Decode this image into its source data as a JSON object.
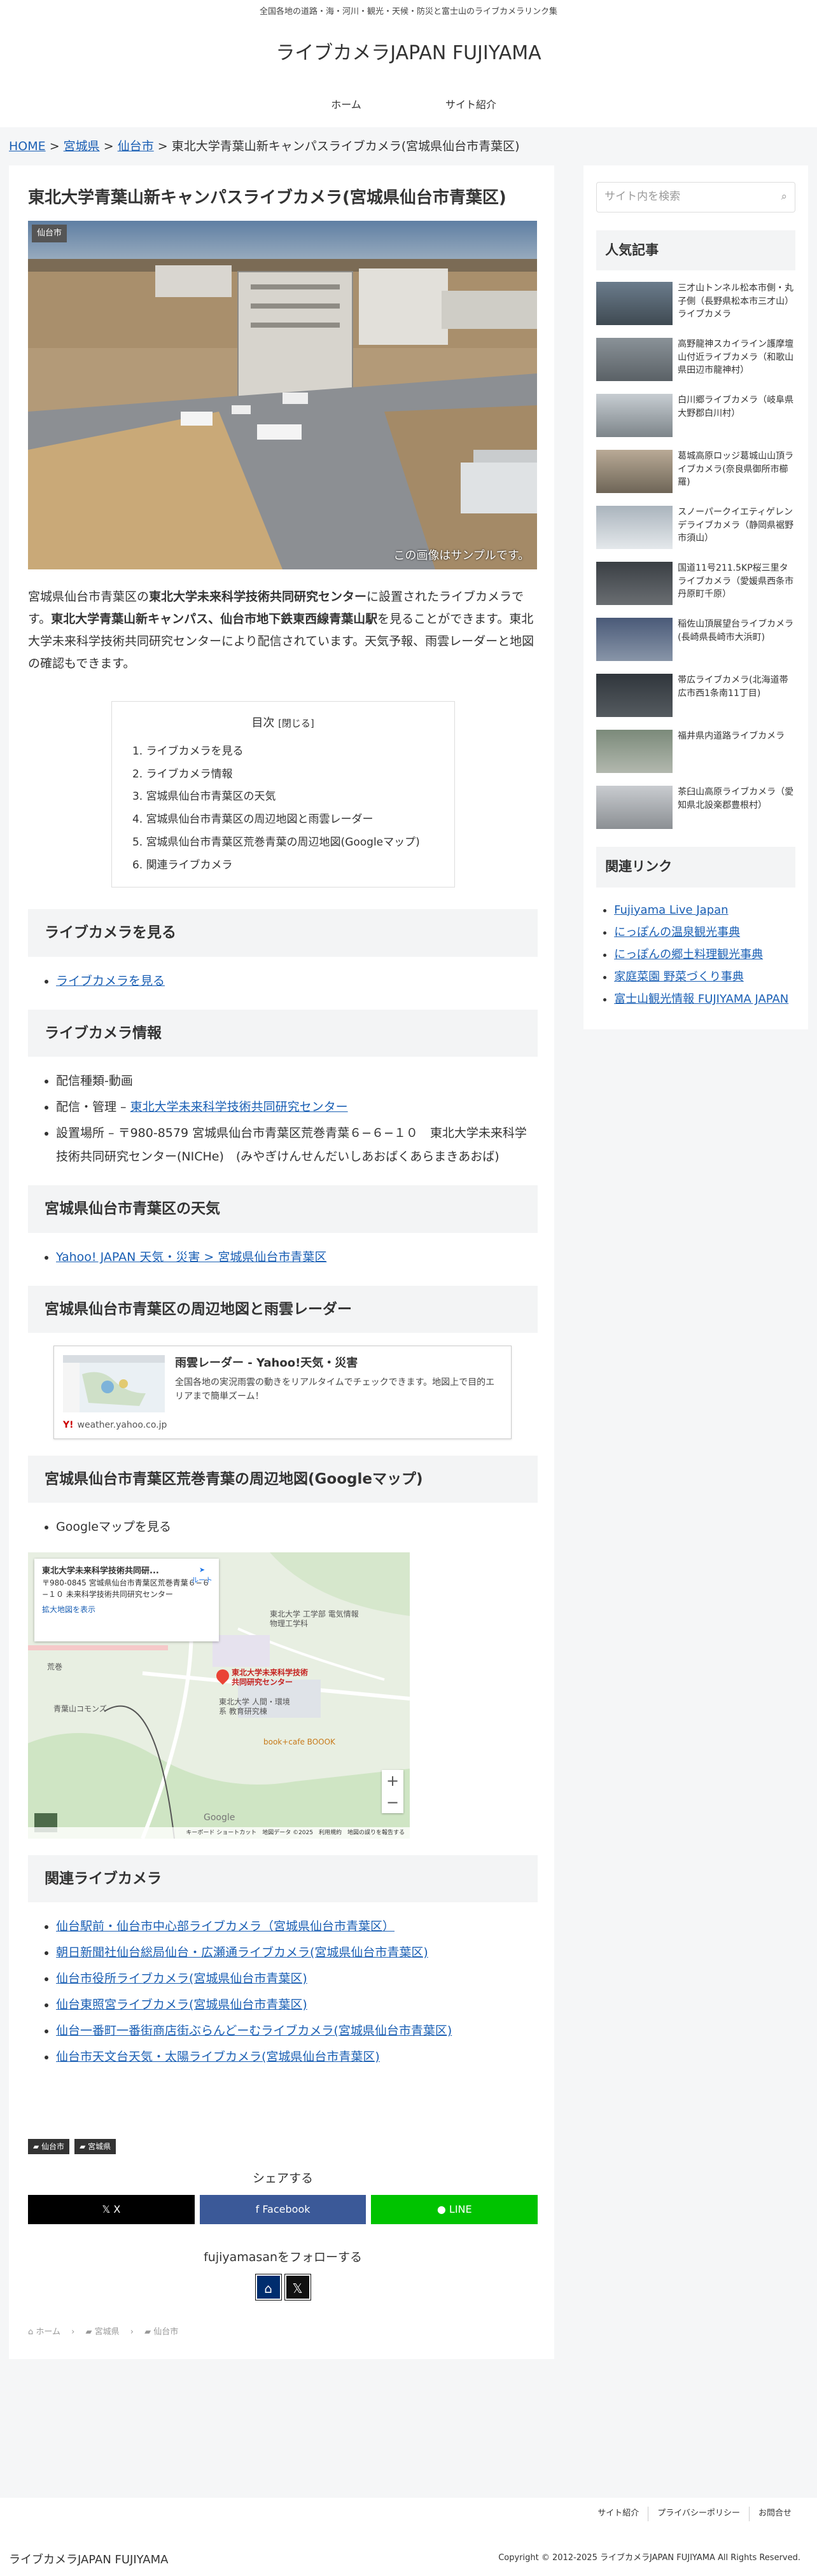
{
  "header": {
    "tagline": "全国各地の道路・海・河川・観光・天候・防災と富士山のライブカメラリンク集",
    "site_name": "ライブカメラJAPAN FUJIYAMA",
    "nav": [
      "ホーム",
      "サイト紹介"
    ]
  },
  "breadcrumb": {
    "home": "HOME",
    "pref": "宮城県",
    "city": "仙台市",
    "current": "東北大学青葉山新キャンパスライブカメラ(宮城県仙台市青葉区)",
    "sep": ">"
  },
  "article": {
    "title": "東北大学青葉山新キャンパスライブカメラ(宮城県仙台市青葉区)",
    "category_label": "仙台市",
    "sample_note": "この画像はサンプルです。",
    "lead_1": "宮城県仙台市青葉区の",
    "lead_b1": "東北大学未来科学技術共同研究センター",
    "lead_2": "に設置されたライブカメラです。",
    "lead_b2": "東北大学青葉山新キャンパス、仙台市地下鉄東西線青葉山駅",
    "lead_3": "を見ることができます。東北大学未来科学技術共同研究センターにより配信されています。天気予報、雨雲レーダーと地図の確認もできます。",
    "toc": {
      "title": "目次",
      "toggle": "[閉じる]",
      "items": [
        "ライブカメラを見る",
        "ライブカメラ情報",
        "宮城県仙台市青葉区の天気",
        "宮城県仙台市青葉区の周辺地図と雨雲レーダー",
        "宮城県仙台市青葉区荒巻青葉の周辺地図(Googleマップ)",
        "関連ライブカメラ"
      ]
    },
    "sections": {
      "watch": {
        "heading": "ライブカメラを見る",
        "link": "ライブカメラを見る"
      },
      "info": {
        "heading": "ライブカメラ情報",
        "item1": "配信種類-動画",
        "item2_prefix": "配信・管理 – ",
        "item2_link": "東北大学未来科学技術共同研究センター",
        "item3": "設置場所 – 〒980-8579 宮城県仙台市青葉区荒巻青葉６−６−１０　東北大学未来科学技術共同研究センター(NICHe)　(みやぎけんせんだいしあおばくあらまきあおば)"
      },
      "weather": {
        "heading": "宮城県仙台市青葉区の天気",
        "link": "Yahoo! JAPAN 天気・災害 > 宮城県仙台市青葉区"
      },
      "radar": {
        "heading": "宮城県仙台市青葉区の周辺地図と雨雲レーダー",
        "card_title": "雨雲レーダー - Yahoo!天気・災害",
        "card_desc": "全国各地の実況雨雲の動きをリアルタイムでチェックできます。地図上で目的エリアまで簡単ズーム！",
        "card_site": "weather.yahoo.co.jp",
        "card_fav": "Y!"
      },
      "gmap": {
        "heading": "宮城県仙台市青葉区荒巻青葉の周辺地図(Googleマップ)",
        "item": "Googleマップを見る",
        "card_title": "東北大学未来科学技術共同研...",
        "card_addr": "〒980-0845 宮城県仙台市青葉区荒巻青葉６−６−１０ 未来科学技術共同研究センター",
        "card_link": "拡大地図を表示",
        "card_route": "ルート",
        "pin_label": "東北大学未来科学技術共同研究センター",
        "place1": "東北大学 工学部 電気情報物理工学科",
        "place2": "青葉山コモンズ",
        "place3": "東北大学 人間・環境系 教育研究棟",
        "place4": "book+cafe BOOOK",
        "place5": "荒巻",
        "zoom_in": "+",
        "zoom_out": "−",
        "google": "Google",
        "footer": "キーボード ショートカット　地図データ ©2025　利用規約　地図の誤りを報告する"
      },
      "related": {
        "heading": "関連ライブカメラ",
        "links": [
          "仙台駅前・仙台市中心部ライブカメラ（宮城県仙台市青葉区）",
          "朝日新聞社仙台総局仙台・広瀬通ライブカメラ(宮城県仙台市青葉区)",
          "仙台市役所ライブカメラ(宮城県仙台市青葉区)",
          "仙台東照宮ライブカメラ(宮城県仙台市青葉区)",
          "仙台一番町一番街商店街ぶらんどーむライブカメラ(宮城県仙台市青葉区)",
          "仙台市天文台天気・太陽ライブカメラ(宮城県仙台市青葉区)"
        ]
      }
    },
    "tags": [
      "仙台市",
      "宮城県"
    ],
    "share": {
      "title": "シェアする",
      "x": "X",
      "facebook": "Facebook",
      "line": "LINE"
    },
    "follow": {
      "title": "fujiyamasanをフォローする"
    },
    "bottom_breadcrumb": [
      "ホーム",
      "宮城県",
      "仙台市"
    ]
  },
  "sidebar": {
    "search_placeholder": "サイト内を検索",
    "popular_title": "人気記事",
    "popular": [
      "三才山トンネル松本市側・丸子側（長野県松本市三才山）ライブカメラ",
      "高野龍神スカイライン護摩壇山付近ライブカメラ（和歌山県田辺市龍神村）",
      "白川郷ライブカメラ（岐阜県大野郡白川村）",
      "葛城高原ロッジ葛城山山頂ライブカメラ(奈良県御所市櫛羅)",
      "スノーパークイエティゲレンデライブカメラ（静岡県裾野市須山）",
      "国道11号211.5KP桜三里タライブカメラ（愛媛県西条市丹原町千原）",
      "稲佐山頂展望台ライブカメラ(長崎県長崎市大浜町)",
      "帯広ライブカメラ(北海道帯広市西1条南11丁目)",
      "福井県内道路ライブカメラ",
      "茶臼山高原ライブカメラ（愛知県北設楽郡豊根村）"
    ],
    "links_title": "関連リンク",
    "links": [
      "Fujiyama Live Japan",
      "にっぽんの温泉観光事典",
      "にっぽんの郷土料理観光事典",
      "家庭菜園 野菜づくり事典",
      "富士山観光情報 FUJIYAMA JAPAN"
    ]
  },
  "footer": {
    "links": [
      "サイト紹介",
      "プライバシーポリシー",
      "お問合せ"
    ],
    "logo": "ライブカメラJAPAN FUJIYAMA",
    "copyright": "Copyright © 2012-2025 ライブカメラJAPAN FUJIYAMA All Rights Reserved."
  },
  "colors": {
    "link": "#1a5fb4",
    "x": "#000000",
    "facebook": "#3b5998",
    "line": "#00c300"
  }
}
